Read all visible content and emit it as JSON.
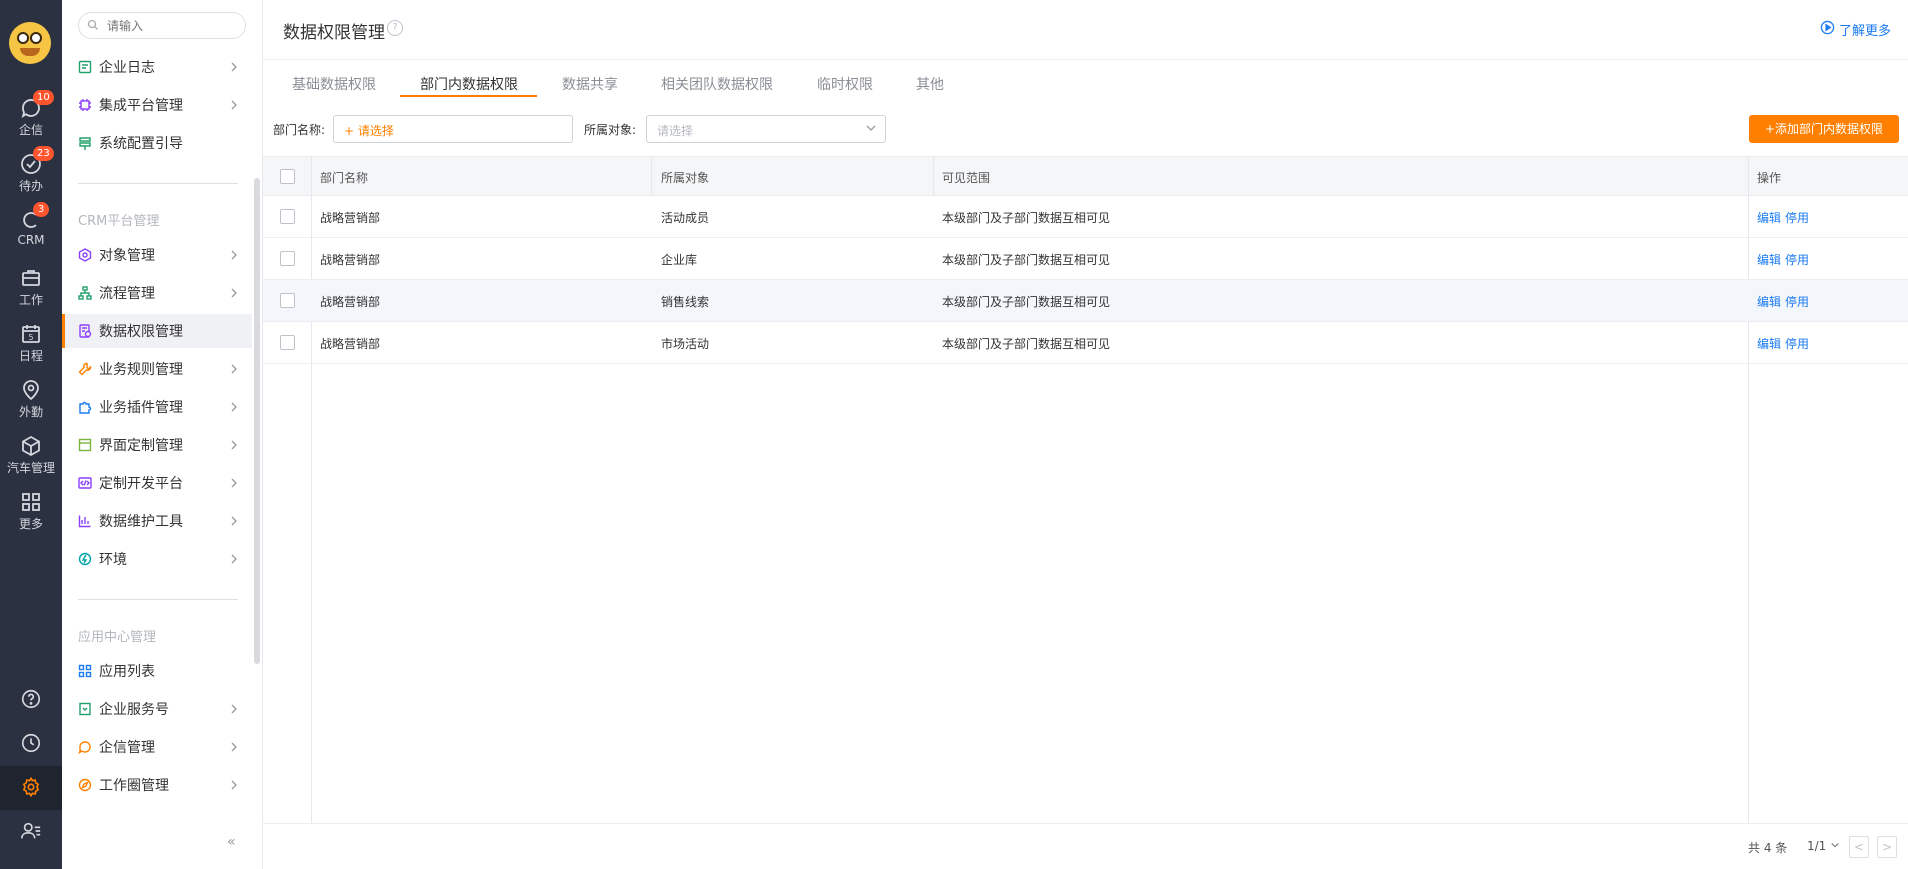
{
  "rail": {
    "items": [
      {
        "label": "企信",
        "badge": "10",
        "icon": "chat-icon"
      },
      {
        "label": "待办",
        "badge": "23",
        "icon": "check-circle-icon"
      },
      {
        "label": "CRM",
        "badge": "3",
        "icon": "crm-icon"
      },
      {
        "label": "工作",
        "badge": "",
        "icon": "briefcase-icon"
      },
      {
        "label": "日程",
        "badge": "",
        "icon": "calendar-icon"
      },
      {
        "label": "外勤",
        "badge": "",
        "icon": "location-icon"
      },
      {
        "label": "汽车管理",
        "badge": "",
        "icon": "cube-icon"
      },
      {
        "label": "更多",
        "badge": "",
        "icon": "grid-icon"
      }
    ],
    "calendar_day": "5"
  },
  "sidebar": {
    "search_placeholder": "请输入",
    "top_items": [
      {
        "label": "企业日志",
        "color": "#22a06b"
      },
      {
        "label": "集成平台管理",
        "color": "#8a3ffc"
      },
      {
        "label": "系统配置引导",
        "color": "#22a06b"
      }
    ],
    "crm_section": "CRM平台管理",
    "crm_items": [
      {
        "label": "对象管理",
        "color": "#8a3ffc"
      },
      {
        "label": "流程管理",
        "color": "#22a06b"
      },
      {
        "label": "数据权限管理",
        "color": "#8a3ffc"
      },
      {
        "label": "业务规则管理",
        "color": "#ff8000"
      },
      {
        "label": "业务插件管理",
        "color": "#1a7bf2"
      },
      {
        "label": "界面定制管理",
        "color": "#7cb342"
      },
      {
        "label": "定制开发平台",
        "color": "#8a3ffc"
      },
      {
        "label": "数据维护工具",
        "color": "#8a3ffc"
      },
      {
        "label": "环境",
        "color": "#00a2a8"
      }
    ],
    "app_section": "应用中心管理",
    "app_items": [
      {
        "label": "应用列表",
        "color": "#1a7bf2"
      },
      {
        "label": "企业服务号",
        "color": "#22a06b"
      },
      {
        "label": "企信管理",
        "color": "#ff8000"
      },
      {
        "label": "工作圈管理",
        "color": "#ff8000"
      }
    ],
    "collapse_label": "«"
  },
  "header": {
    "title": "数据权限管理",
    "help_label": "?",
    "learn_more": "了解更多"
  },
  "tabs": [
    "基础数据权限",
    "部门内数据权限",
    "数据共享",
    "相关团队数据权限",
    "临时权限",
    "其他"
  ],
  "filters": {
    "dept_label": "部门名称:",
    "dept_value": "+ 请选择",
    "object_label": "所属对象:",
    "object_placeholder": "请选择",
    "add_button": "+添加部门内数据权限"
  },
  "table": {
    "columns": [
      "部门名称",
      "所属对象",
      "可见范围",
      "操作"
    ],
    "rows": [
      {
        "dept": "战略营销部",
        "object": "活动成员",
        "scope": "本级部门及子部门数据互相可见",
        "edit": "编辑",
        "disable": "停用"
      },
      {
        "dept": "战略营销部",
        "object": "企业库",
        "scope": "本级部门及子部门数据互相可见",
        "edit": "编辑",
        "disable": "停用"
      },
      {
        "dept": "战略营销部",
        "object": "销售线索",
        "scope": "本级部门及子部门数据互相可见",
        "edit": "编辑",
        "disable": "停用"
      },
      {
        "dept": "战略营销部",
        "object": "市场活动",
        "scope": "本级部门及子部门数据互相可见",
        "edit": "编辑",
        "disable": "停用"
      }
    ]
  },
  "footer": {
    "total": "共 4 条",
    "page": "1/1",
    "prev": "<",
    "next": ">"
  },
  "colors": {
    "accent": "#ff8000",
    "link": "#1a7bf2",
    "rail_bg": "#2b3140"
  }
}
